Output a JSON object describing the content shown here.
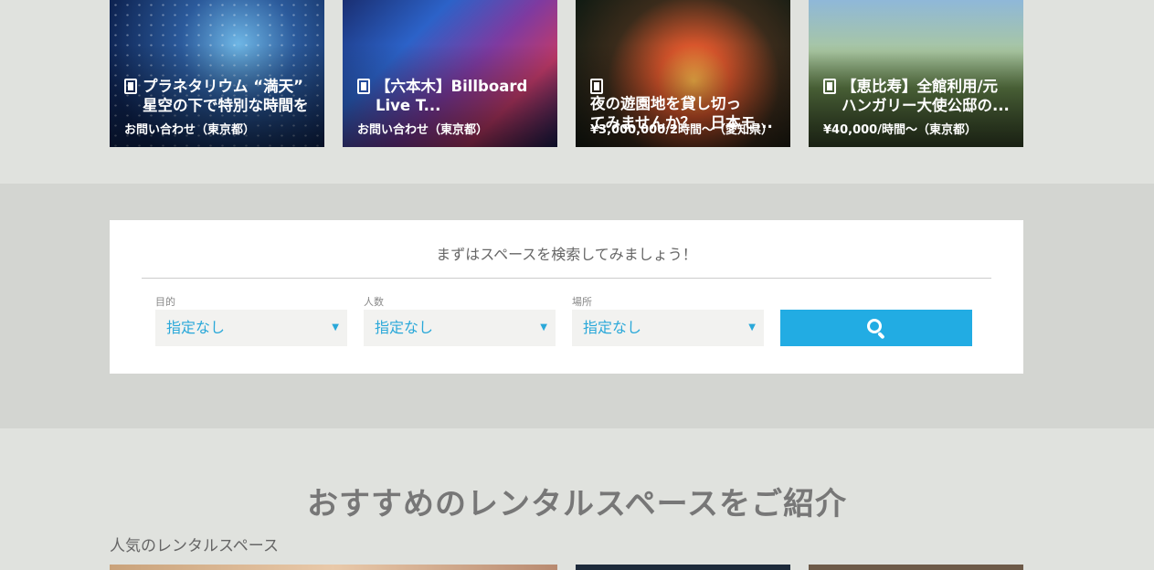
{
  "top_cards": [
    {
      "title": "プラネタリウム “満天”\n星空の下で特別な時間を",
      "price": "お問い合わせ（東京都）"
    },
    {
      "title": "【六本木】Billboard\nLive T...",
      "price": "お問い合わせ（東京都）"
    },
    {
      "title": "夜の遊園地を貸し切っ\nてみませんか？　日本モ...",
      "price": "¥3,000,000/2時間〜（愛知県）"
    },
    {
      "title": "【恵比寿】全館利用/元\nハンガリー大使公邸の...",
      "price": "¥40,000/時間〜（東京都）"
    }
  ],
  "search": {
    "heading": "まずはスペースを検索してみましょう！",
    "fields": [
      {
        "label": "目的",
        "value": "指定なし"
      },
      {
        "label": "人数",
        "value": "指定なし"
      },
      {
        "label": "場所",
        "value": "指定なし"
      }
    ],
    "caret": "▼",
    "button_icon": "search-icon"
  },
  "recommend": {
    "title": "おすすめのレンタルスペースをご紹介",
    "subtitle": "人気のレンタルスペース"
  },
  "colors": {
    "accent": "#22ace3",
    "select_text": "#2aa8d9"
  }
}
